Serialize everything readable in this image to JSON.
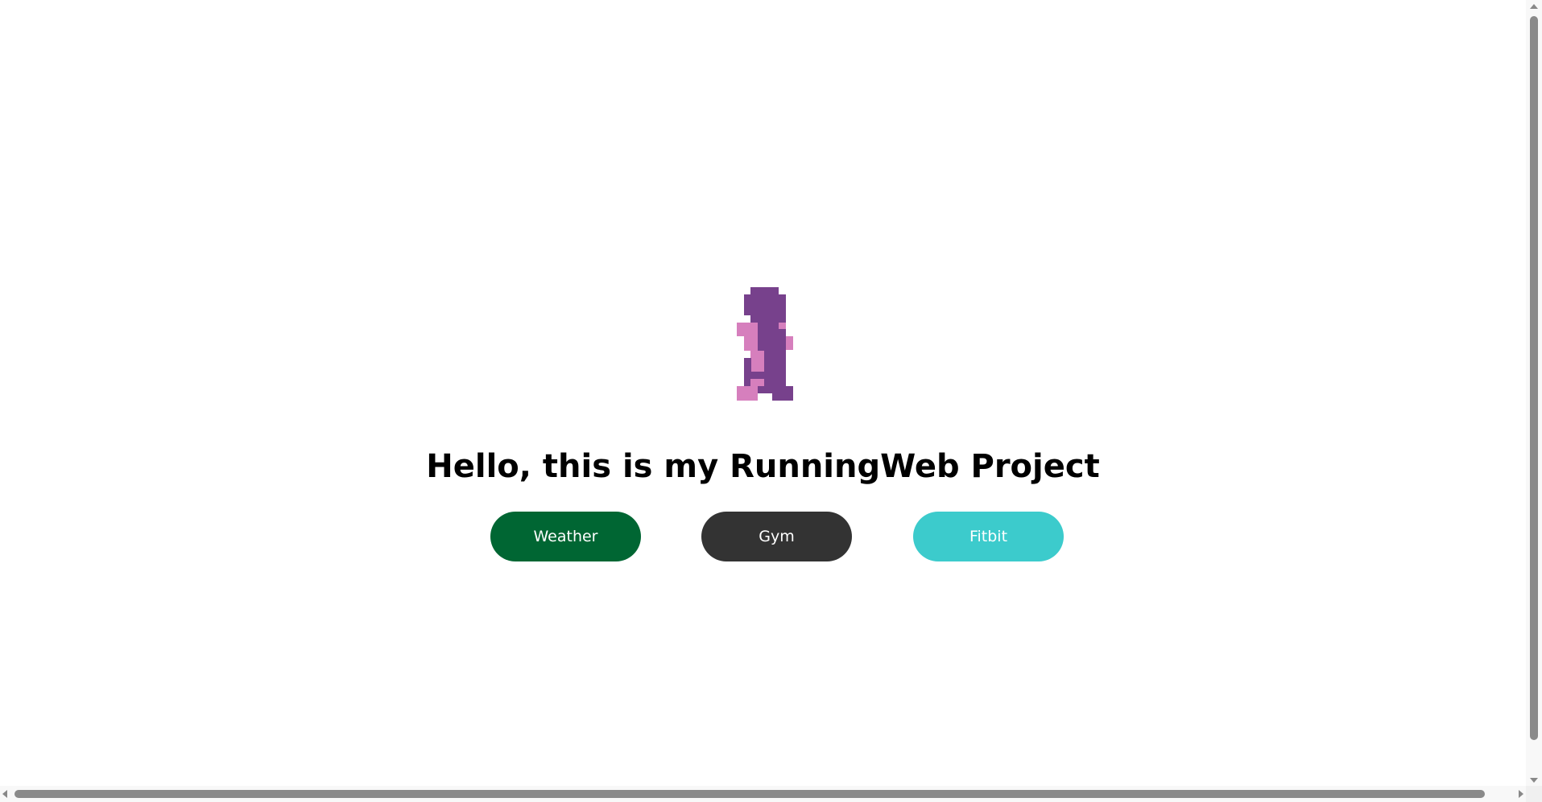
{
  "main": {
    "heading": "Hello, this is my RunningWeb Project",
    "sprite_icon": "pixel-runner-icon",
    "buttons": [
      {
        "label": "Weather",
        "color": "#006633"
      },
      {
        "label": "Gym",
        "color": "#333333"
      },
      {
        "label": "Fitbit",
        "color": "#3ccbcc"
      }
    ]
  },
  "colors": {
    "sprite_primary": "#77418c",
    "sprite_secondary": "#d67fbd"
  }
}
